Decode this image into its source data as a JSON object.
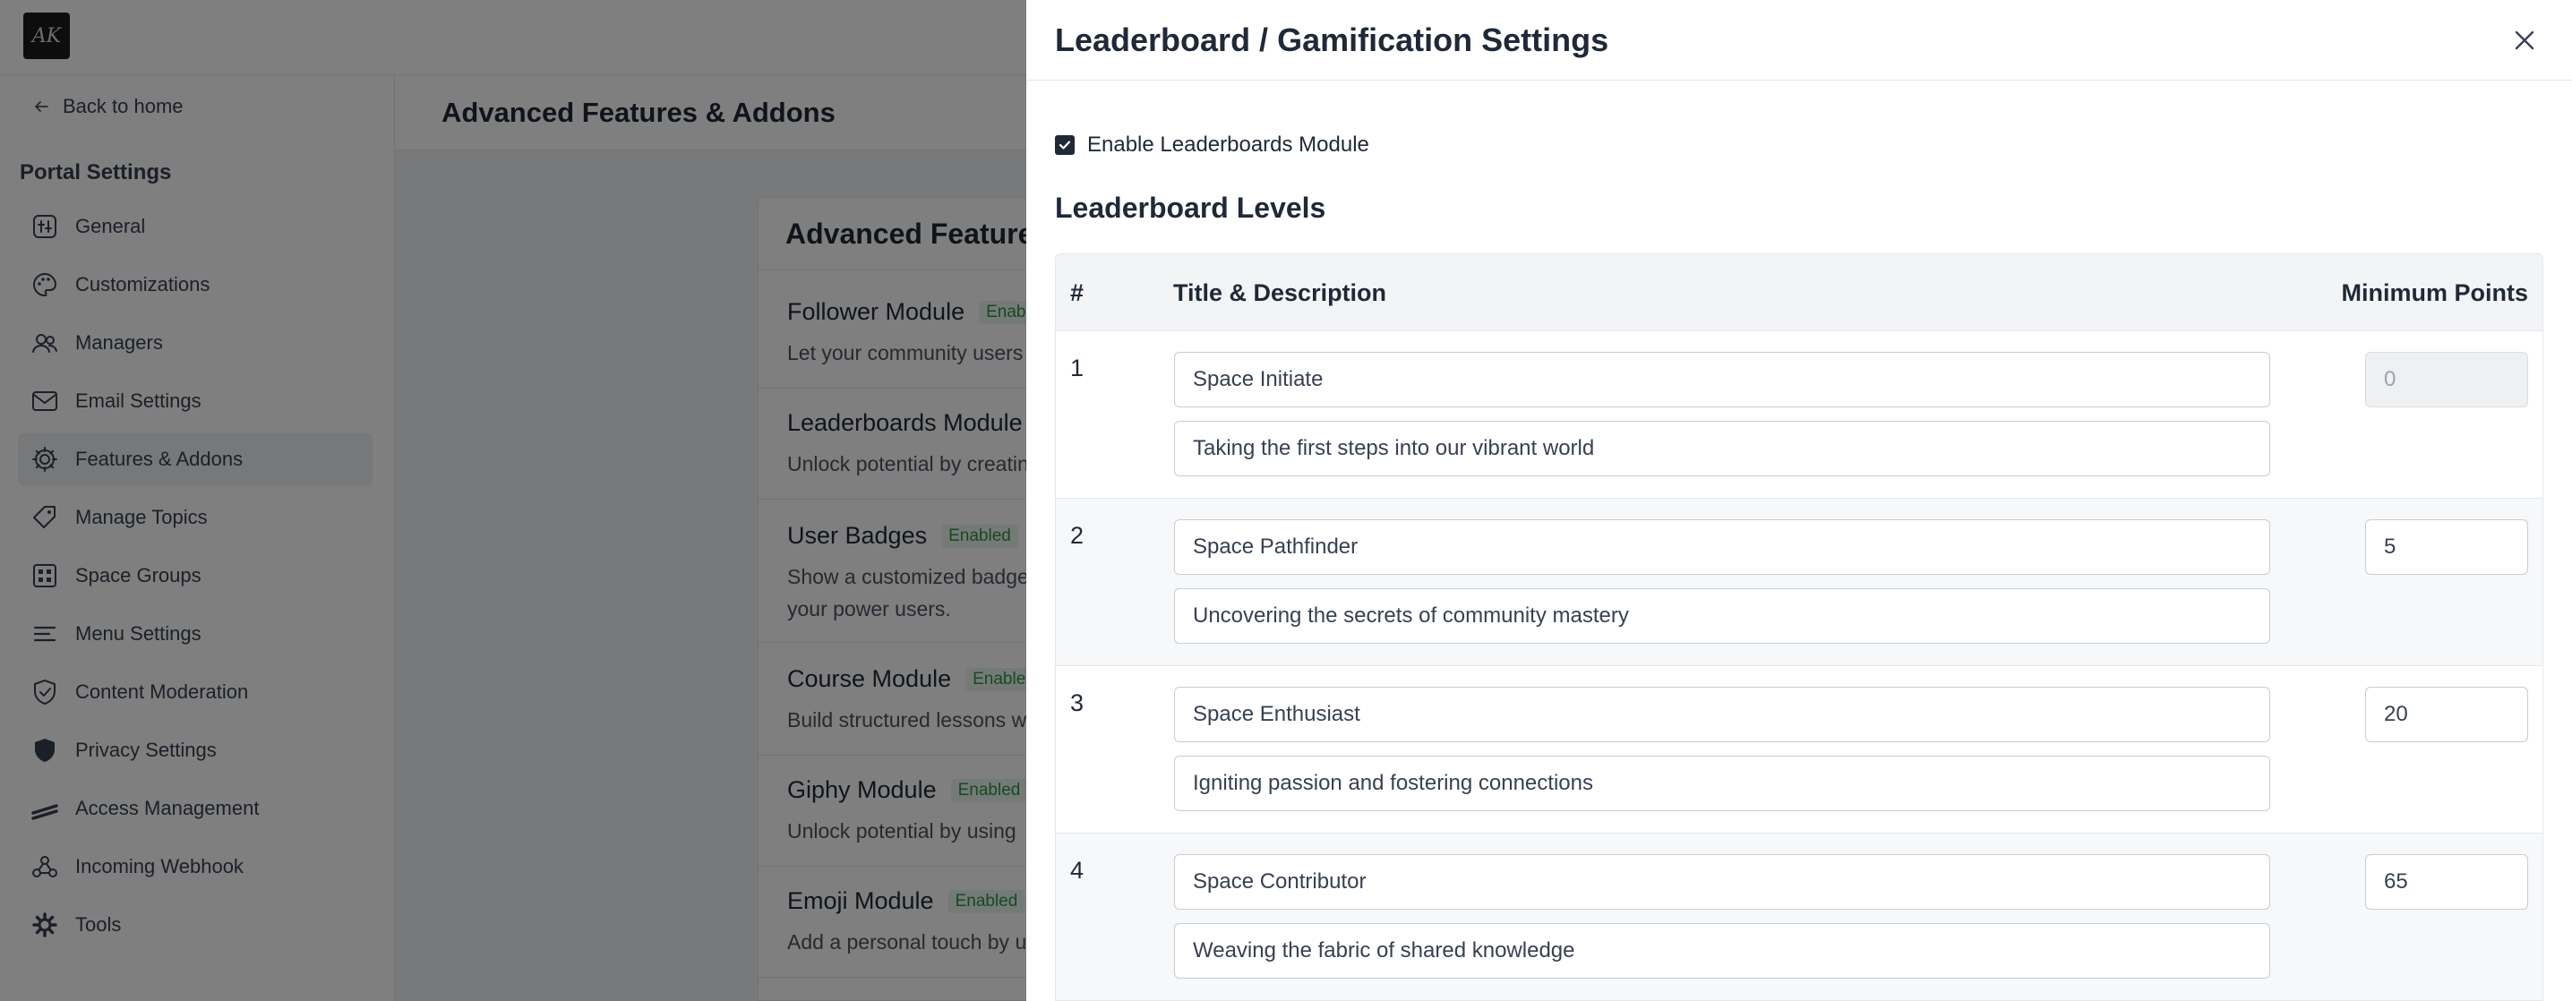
{
  "topbar": {
    "logo_text": "AK"
  },
  "sidebar": {
    "back_label": "Back to home",
    "section_title": "Portal Settings",
    "items": [
      {
        "label": "General",
        "icon": "general-icon"
      },
      {
        "label": "Customizations",
        "icon": "palette-icon"
      },
      {
        "label": "Managers",
        "icon": "users-icon"
      },
      {
        "label": "Email Settings",
        "icon": "mail-icon"
      },
      {
        "label": "Features & Addons",
        "icon": "gear-icon",
        "active": true
      },
      {
        "label": "Manage Topics",
        "icon": "tag-icon"
      },
      {
        "label": "Space Groups",
        "icon": "grid-icon"
      },
      {
        "label": "Menu Settings",
        "icon": "menu-icon"
      },
      {
        "label": "Content Moderation",
        "icon": "shield-check-icon"
      },
      {
        "label": "Privacy Settings",
        "icon": "shield-icon"
      },
      {
        "label": "Access Management",
        "icon": "access-icon"
      },
      {
        "label": "Incoming Webhook",
        "icon": "webhook-icon"
      },
      {
        "label": "Tools",
        "icon": "tools-icon"
      }
    ]
  },
  "main": {
    "title": "Advanced Features & Addons",
    "card_title": "Advanced Features",
    "features": [
      {
        "name": "Follower Module",
        "badge": "Enabled",
        "desc": "Let your community users"
      },
      {
        "name": "Leaderboards Module",
        "badge": "",
        "desc": "Unlock potential by creatin"
      },
      {
        "name": "User Badges",
        "badge": "Enabled",
        "desc": "Show a customized badge",
        "desc2": "your power users."
      },
      {
        "name": "Course Module",
        "badge": "Enabled",
        "desc": "Build structured lessons w"
      },
      {
        "name": "Giphy Module",
        "badge": "Enabled",
        "desc": "Unlock potential by using"
      },
      {
        "name": "Emoji Module",
        "badge": "Enabled",
        "desc": "Add a personal touch by u"
      }
    ]
  },
  "drawer": {
    "title": "Leaderboard / Gamification Settings",
    "enable_label": "Enable Leaderboards Module",
    "enabled": true,
    "levels_title": "Leaderboard Levels",
    "columns": {
      "num": "#",
      "title": "Title & Description",
      "min": "Minimum Points"
    },
    "levels": [
      {
        "num": "1",
        "title": "Space Initiate",
        "desc": "Taking the first steps into our vibrant world",
        "points": "0"
      },
      {
        "num": "2",
        "title": "Space Pathfinder",
        "desc": "Uncovering the secrets of community mastery",
        "points": "5"
      },
      {
        "num": "3",
        "title": "Space Enthusiast",
        "desc": "Igniting passion and fostering connections",
        "points": "20"
      },
      {
        "num": "4",
        "title": "Space Contributor",
        "desc": "Weaving the fabric of shared knowledge",
        "points": "65"
      }
    ]
  }
}
